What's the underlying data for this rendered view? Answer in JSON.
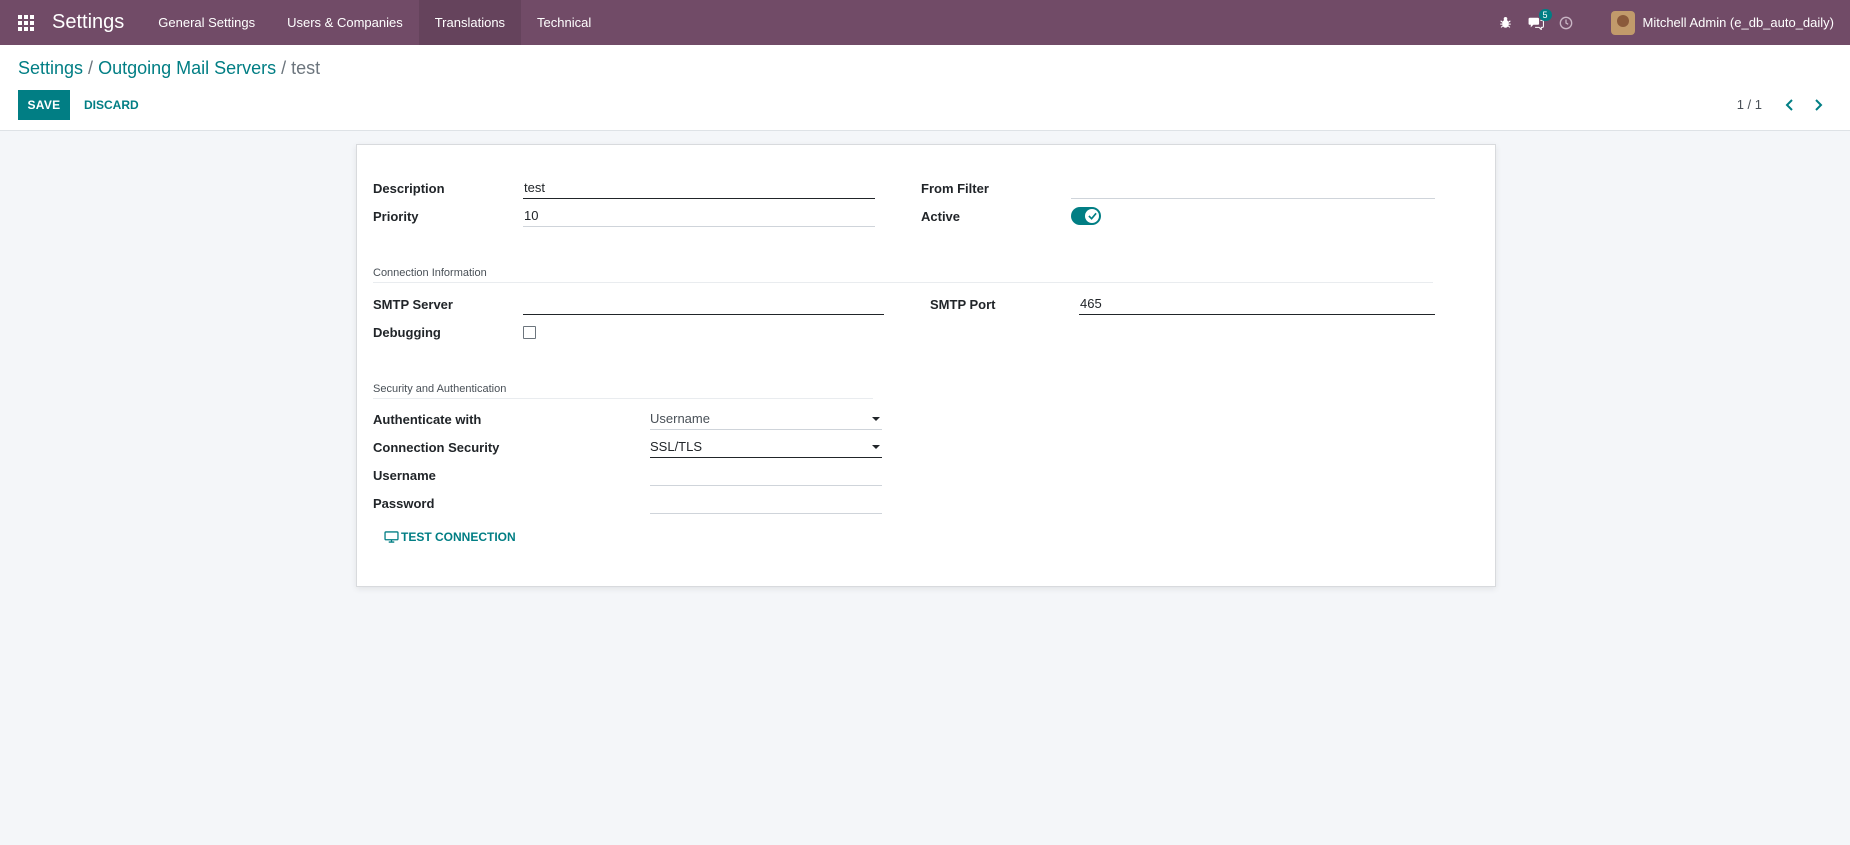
{
  "app": {
    "title": "Settings",
    "menu": [
      "General Settings",
      "Users & Companies",
      "Translations",
      "Technical"
    ],
    "active_menu": "Translations",
    "messages_badge": "5",
    "user_name": "Mitchell Admin (e_db_auto_daily)"
  },
  "breadcrumb": {
    "root": "Settings",
    "sep1": " / ",
    "parent": "Outgoing Mail Servers",
    "sep2": " / ",
    "current": "test"
  },
  "actions": {
    "save": "SAVE",
    "discard": "DISCARD",
    "pager": "1 / 1"
  },
  "form": {
    "description_label": "Description",
    "description_value": "test",
    "priority_label": "Priority",
    "priority_value": "10",
    "from_filter_label": "From Filter",
    "from_filter_value": "",
    "active_label": "Active",
    "active_value": true,
    "connection_section": "Connection Information",
    "smtp_server_label": "SMTP Server",
    "smtp_server_value": "",
    "smtp_port_label": "SMTP Port",
    "smtp_port_value": "465",
    "debugging_label": "Debugging",
    "debugging_value": false,
    "security_section": "Security and Authentication",
    "authenticate_label": "Authenticate with",
    "authenticate_value": "Username",
    "connection_security_label": "Connection Security",
    "connection_security_value": "SSL/TLS",
    "username_label": "Username",
    "username_value": "",
    "password_label": "Password",
    "password_value": "",
    "test_connection": "TEST CONNECTION"
  },
  "colors": {
    "navbar": "#714b67",
    "accent": "#017e84",
    "background": "#f4f6f9"
  }
}
